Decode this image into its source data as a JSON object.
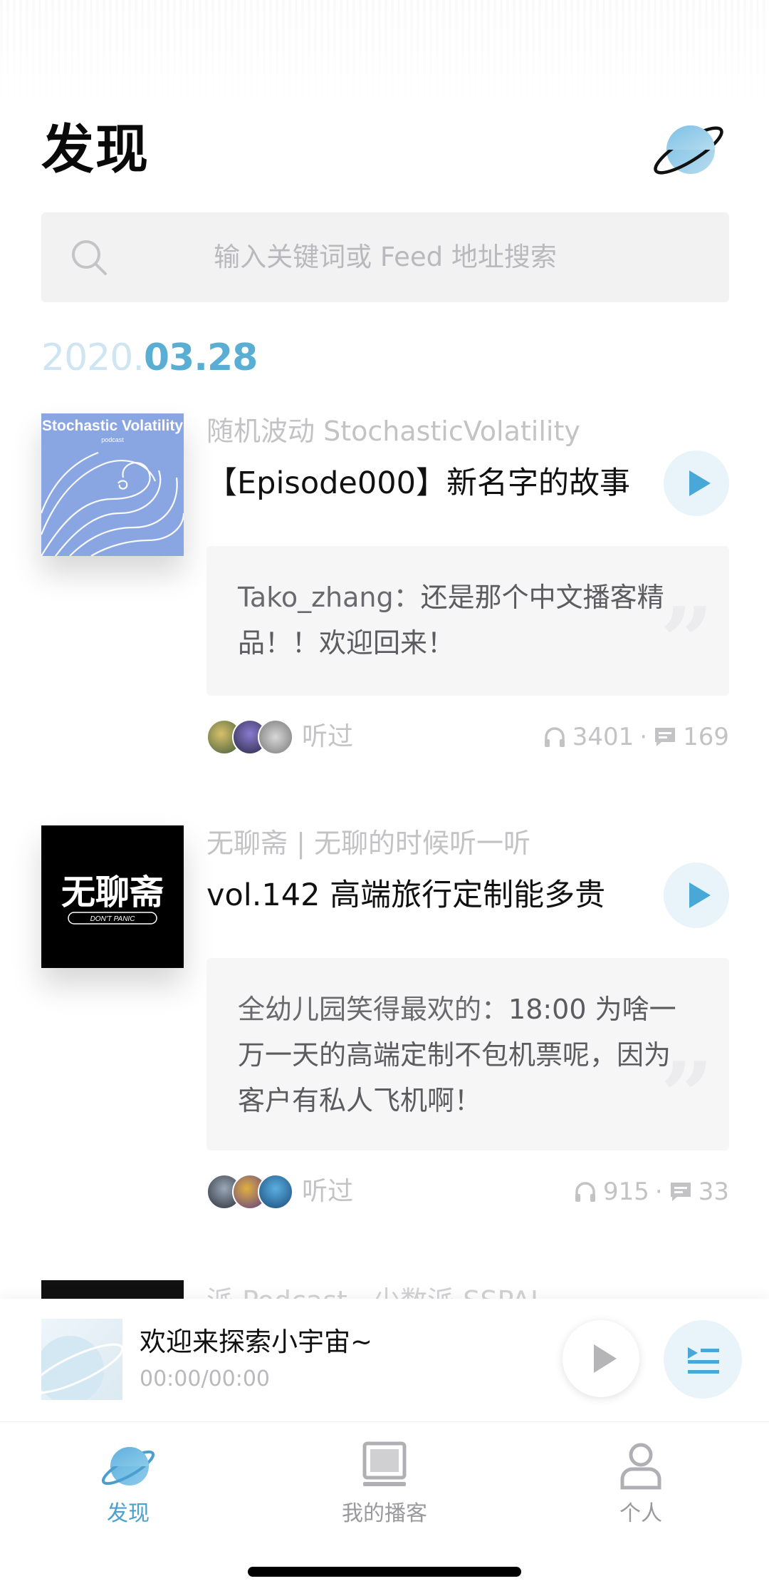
{
  "header": {
    "title": "发现"
  },
  "search": {
    "placeholder": "输入关键词或 Feed 地址搜索"
  },
  "feed": {
    "date_year": "2020.",
    "date_md": "03.28",
    "items": [
      {
        "podcast": "随机波动 StochasticVolatility",
        "episode": "【Episode000】新名字的故事",
        "cover_title": "Stochastic Volatility",
        "cover_subtitle": "podcast",
        "comment_author": "Tako_zhang：",
        "comment_text": "还是那个中文播客精品！！欢迎回来！",
        "listened_label": "听过",
        "listens": "3401",
        "comments": "169"
      },
      {
        "podcast": "无聊斋 | 无聊的时候听一听",
        "episode": "vol.142 高端旅行定制能多贵",
        "cover_title": "无聊斋",
        "cover_subtitle": "DON'T PANIC",
        "comment_author": "全幼儿园笑得最欢的：",
        "comment_text": "18:00 为啥一万一天的高端定制不包机票呢，因为客户有私人飞机啊！",
        "listened_label": "听过",
        "listens": "915",
        "comments": "33"
      }
    ],
    "next_podcast_peek": "派 Podcast · 少数派 SSPAI"
  },
  "player": {
    "title": "欢迎来探索小宇宙~",
    "time": "00:00/00:00"
  },
  "tabs": [
    {
      "label": "发现",
      "icon": "planet-icon",
      "active": true
    },
    {
      "label": "我的播客",
      "icon": "monitor-icon",
      "active": false
    },
    {
      "label": "个人",
      "icon": "person-icon",
      "active": false
    }
  ],
  "colors": {
    "accent": "#4aa8d8",
    "date_light": "#cfe5f1",
    "date_dark": "#5aaed3"
  }
}
